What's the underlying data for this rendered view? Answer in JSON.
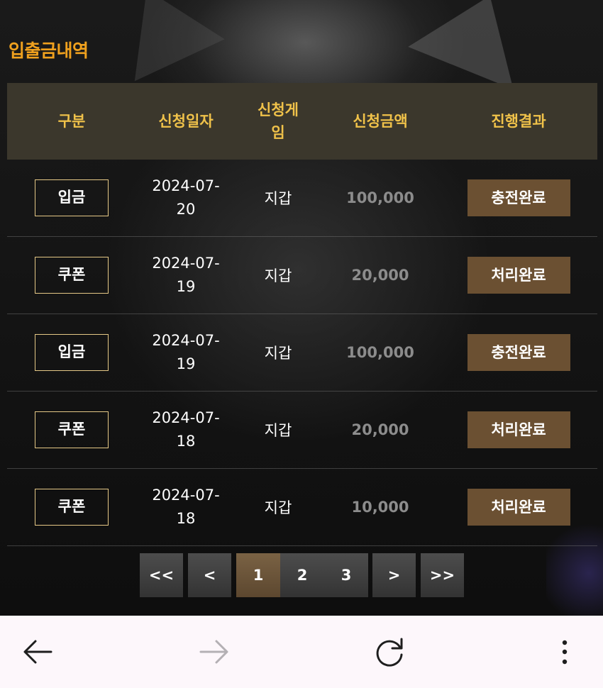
{
  "page": {
    "title": "입출금내역"
  },
  "table": {
    "headers": [
      "구분",
      "신청일자",
      "신청게\n임",
      "신청금액",
      "진행결과"
    ],
    "rows": [
      {
        "type": "입금",
        "date": "2024-07-\n20",
        "game": "지갑",
        "amount": "100,000",
        "status": "충전완료"
      },
      {
        "type": "쿠폰",
        "date": "2024-07-\n19",
        "game": "지갑",
        "amount": "20,000",
        "status": "처리완료"
      },
      {
        "type": "입금",
        "date": "2024-07-\n19",
        "game": "지갑",
        "amount": "100,000",
        "status": "충전완료"
      },
      {
        "type": "쿠폰",
        "date": "2024-07-\n18",
        "game": "지갑",
        "amount": "20,000",
        "status": "처리완료"
      },
      {
        "type": "쿠폰",
        "date": "2024-07-\n18",
        "game": "지갑",
        "amount": "10,000",
        "status": "처리완료"
      }
    ]
  },
  "pagination": {
    "first": "<<",
    "prev": "<",
    "pages": [
      "1",
      "2",
      "3"
    ],
    "next": ">",
    "last": ">>",
    "current": "1"
  },
  "browser_nav": {
    "back_icon": "arrow-left-icon",
    "forward_icon": "arrow-right-icon",
    "reload_icon": "reload-icon",
    "menu_icon": "more-vertical-icon"
  },
  "colors": {
    "title": "#f0a11e",
    "header_bg": "#3b372c",
    "header_text": "#f0c24a",
    "badge_border": "#e5c886",
    "status_bg": "#6b5032",
    "amount_text": "#8c8c8c",
    "page_active": "#7a6244"
  }
}
